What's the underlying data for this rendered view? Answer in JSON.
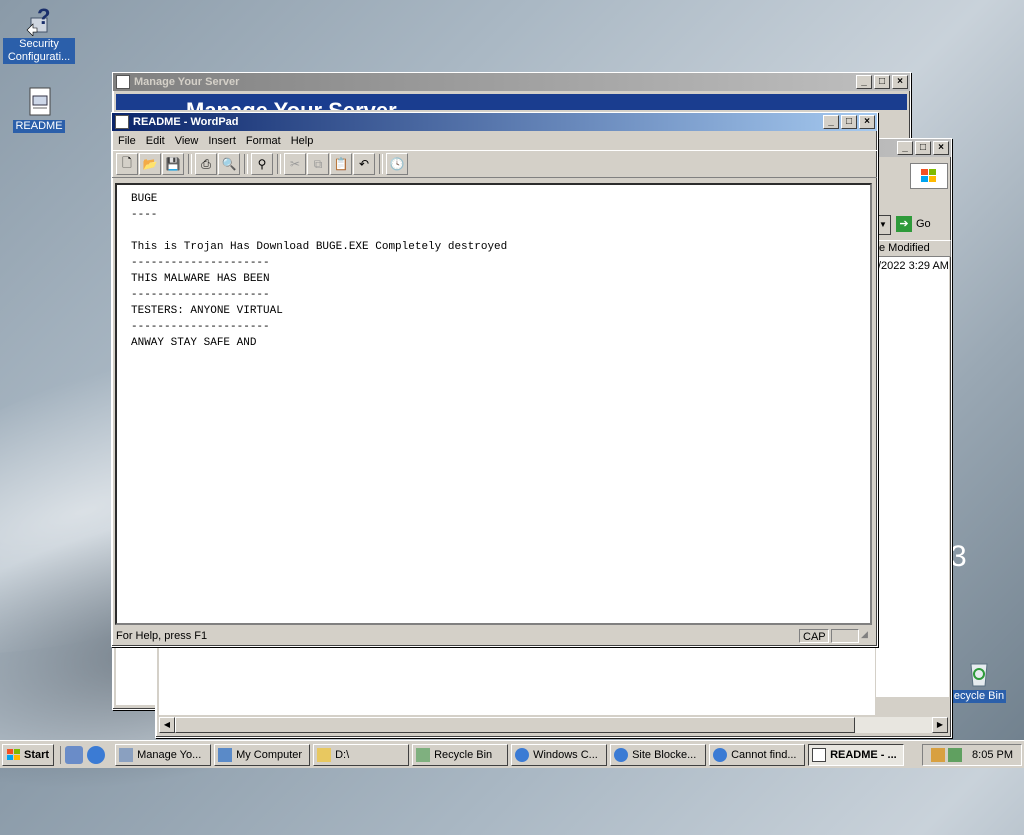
{
  "desktop": {
    "icons": [
      {
        "label": "Security Configurati...",
        "icon": "security-config-wizard-icon"
      },
      {
        "label": "README",
        "icon": "document-icon"
      },
      {
        "label": "ecycle Bin",
        "icon": "recycle-bin-icon"
      }
    ],
    "background_digit": "3"
  },
  "manage_server": {
    "title": "Manage Your Server",
    "banner_text": "Manage Your Server"
  },
  "explorer": {
    "go_label": "Go",
    "column_header": "e Modified",
    "row_value": "/2022 3:29 AM"
  },
  "wordpad": {
    "title": "README - WordPad",
    "menu": [
      "File",
      "Edit",
      "View",
      "Insert",
      "Format",
      "Help"
    ],
    "toolbar_icons": [
      "new-icon",
      "open-icon",
      "save-icon",
      "print-icon",
      "print-preview-icon",
      "find-icon",
      "cut-icon",
      "copy-icon",
      "paste-icon",
      "undo-icon",
      "insert-datetime-icon"
    ],
    "document_text": "BUGE\n----\n\nThis is Trojan Has Download BUGE.EXE Completely destroyed\n---------------------\nTHIS MALWARE HAS BEEN\n---------------------\nTESTERS: ANYONE VIRTUAL\n---------------------\nANWAY STAY SAFE AND",
    "status_help": "For Help, press F1",
    "status_cap": "CAP"
  },
  "taskbar": {
    "start_label": "Start",
    "tasks": [
      {
        "label": "Manage Yo...",
        "icon": "server-icon",
        "active": false
      },
      {
        "label": "My Computer",
        "icon": "computer-icon",
        "active": false
      },
      {
        "label": "D:\\",
        "icon": "folder-icon",
        "active": false
      },
      {
        "label": "Recycle Bin",
        "icon": "recycle-bin-icon",
        "active": false
      },
      {
        "label": "Windows C...",
        "icon": "ie-icon",
        "active": false
      },
      {
        "label": "Site Blocke...",
        "icon": "ie-icon",
        "active": false
      },
      {
        "label": "Cannot find...",
        "icon": "ie-icon",
        "active": false
      },
      {
        "label": "README - ...",
        "icon": "wordpad-icon",
        "active": true
      }
    ],
    "clock": "8:05 PM"
  }
}
